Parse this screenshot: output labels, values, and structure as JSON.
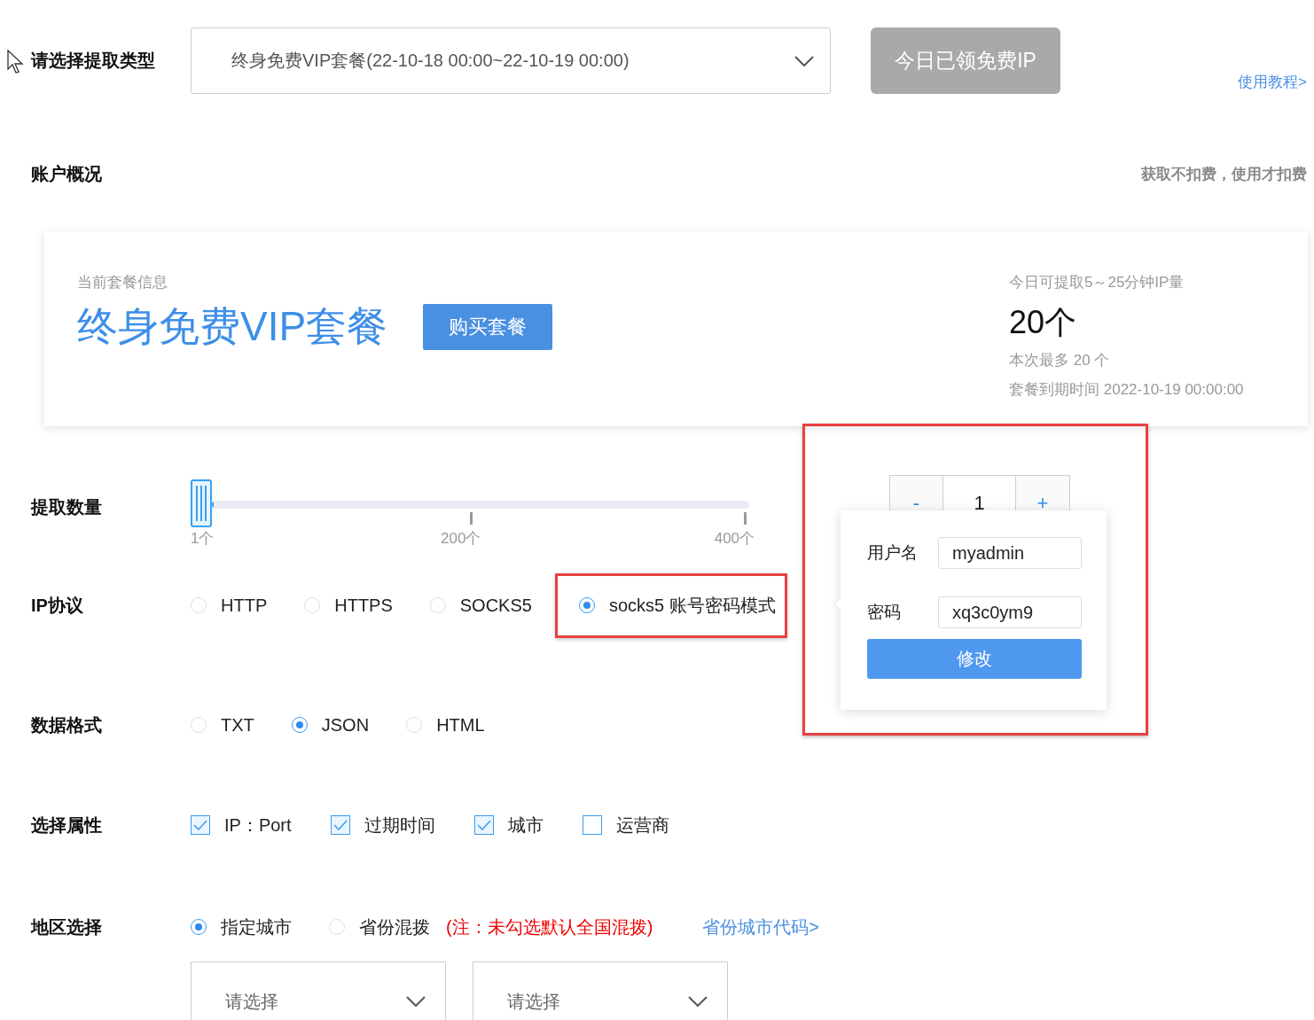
{
  "type_row": {
    "label": "请选择提取类型",
    "select_value": "终身免费VIP套餐(22-10-18 00:00~22-10-19 00:00)",
    "claim_button": {
      "label": "今日已领免费IP",
      "disabled": true
    },
    "tutorial_link": "使用教程>"
  },
  "overview": {
    "title": "账户概况",
    "note": "获取不扣费，使用才扣费"
  },
  "plan_card": {
    "caption": "当前套餐信息",
    "plan_name": "终身免费VIP套餐",
    "buy_button": "购买套餐",
    "quota_caption": "今日可提取5～25分钟IP量",
    "quota": "20个",
    "max_note": "本次最多 20 个",
    "expiry": "套餐到期时间 2022-10-19 00:00:00"
  },
  "quantity": {
    "label": "提取数量",
    "level": 0,
    "ticks": [
      "1个",
      "200个",
      "400个"
    ],
    "stepper": {
      "minus": "-",
      "value": "1",
      "plus": "+"
    }
  },
  "protocol": {
    "label": "IP协议",
    "options": [
      {
        "label": "HTTP",
        "selected": false,
        "highlighted": false
      },
      {
        "label": "HTTPS",
        "selected": false,
        "highlighted": false
      },
      {
        "label": "SOCKS5",
        "selected": false,
        "highlighted": false
      },
      {
        "label": "socks5 账号密码模式",
        "selected": true,
        "highlighted": true
      }
    ]
  },
  "format": {
    "label": "数据格式",
    "options": [
      {
        "label": "TXT",
        "selected": false
      },
      {
        "label": "JSON",
        "selected": true
      },
      {
        "label": "HTML",
        "selected": false
      }
    ]
  },
  "attributes": {
    "label": "选择属性",
    "options": [
      {
        "label": "IP：Port",
        "checked": true
      },
      {
        "label": "过期时间",
        "checked": true
      },
      {
        "label": "城市",
        "checked": true
      },
      {
        "label": "运营商",
        "checked": false
      }
    ]
  },
  "region": {
    "label": "地区选择",
    "options": [
      {
        "label": "指定城市",
        "selected": true
      },
      {
        "label": "省份混拨",
        "selected": false
      }
    ],
    "note": "(注：未勾选默认全国混拨)",
    "code_link": "省份城市代码>",
    "selects": [
      {
        "placeholder": "请选择"
      },
      {
        "placeholder": "请选择"
      }
    ]
  },
  "account_popover": {
    "highlighted": true,
    "fields": [
      {
        "label": "用户名",
        "value": "myadmin"
      },
      {
        "label": "密码",
        "value": "xq3c0ym9"
      }
    ],
    "submit": "修改"
  }
}
